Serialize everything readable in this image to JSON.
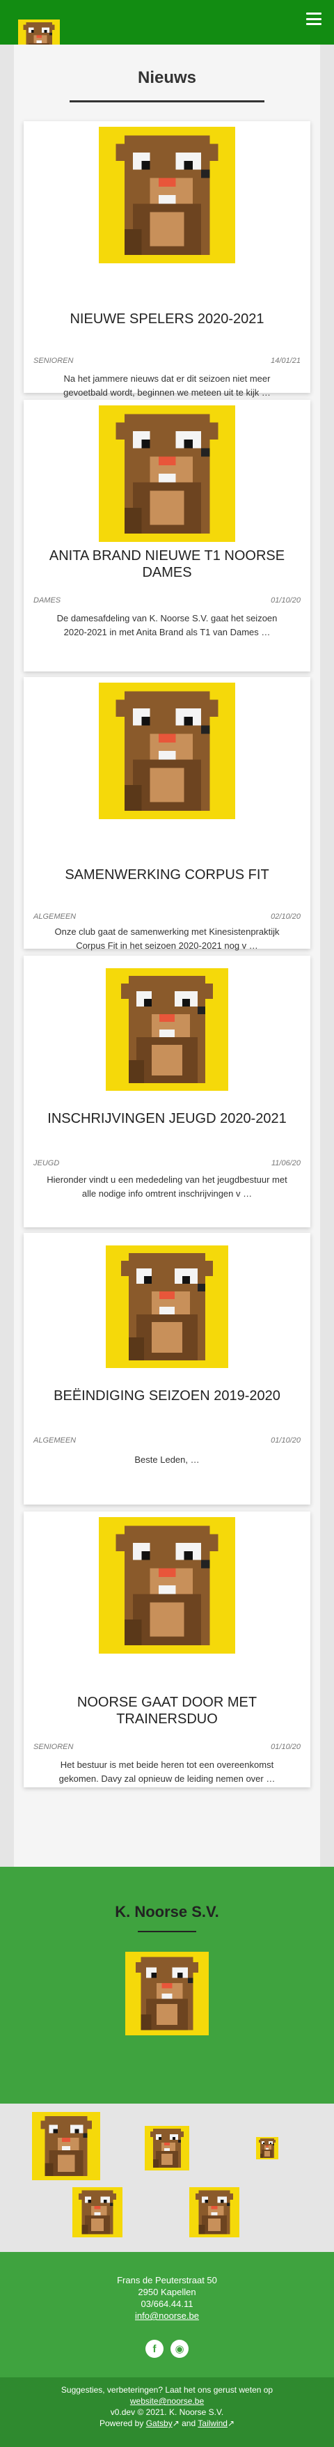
{
  "header": {
    "menu_icon": "hamburger-menu-icon",
    "logo": "beaver-logo-icon"
  },
  "colors": {
    "header_green": "#128c12",
    "band_green": "#3fa33f",
    "dark_green": "#2f8a2f",
    "beaver_brown": "#8a5a2b",
    "beaver_yellow": "#f5d90a"
  },
  "page": {
    "title": "Nieuws"
  },
  "articles": [
    {
      "title": "NIEUWE SPELERS 2020-2021",
      "category": "SENIOREN",
      "date": "14/01/21",
      "excerpt": "Na het jammere nieuws dat er dit seizoen niet meer gevoetbald wordt, beginnen we meteen uit te kijk …"
    },
    {
      "title": "ANITA BRAND NIEUWE T1 NOORSE DAMES",
      "category": "DAMES",
      "date": "01/10/20",
      "excerpt": "De damesafdeling van K. Noorse S.V. gaat het seizoen 2020-2021 in met Anita Brand als T1 van Dames …"
    },
    {
      "title": "SAMENWERKING CORPUS FIT",
      "category": "ALGEMEEN",
      "date": "02/10/20",
      "excerpt": "Onze club gaat de samenwerking met Kinesistenpraktijk Corpus Fit in het seizoen 2020-2021 nog v …"
    },
    {
      "title": "INSCHRIJVINGEN JEUGD 2020-2021",
      "category": "JEUGD",
      "date": "11/06/20",
      "excerpt": "Hieronder vindt u een mededeling van het jeugdbestuur met alle nodige info omtrent inschrijvingen v …"
    },
    {
      "title": "BEËINDIGING SEIZOEN 2019-2020",
      "category": "ALGEMEEN",
      "date": "01/10/20",
      "excerpt": "Beste Leden,    …"
    },
    {
      "title": "NOORSE GAAT DOOR MET TRAINERSDUO",
      "category": "SENIOREN",
      "date": "01/10/20",
      "excerpt": "Het bestuur is met beide heren tot een overeenkomst gekomen. Davy zal opnieuw de leiding nemen over …"
    }
  ],
  "club": {
    "name": "K. Noorse S.V."
  },
  "contact": {
    "address": "Frans de Peuterstraat 50",
    "city": "2950 Kapellen",
    "phone": "03/664.44.11",
    "email": "info@noorse.be"
  },
  "social": {
    "facebook_icon": "facebook-icon",
    "github_icon": "github-icon"
  },
  "footer": {
    "suggestion_text": "Suggesties, verbeteringen? Laat het ons gerust weten op",
    "suggestion_link": "website@noorse.be",
    "version_text": "v0.dev © 2021. K. Noorse S.V.",
    "powered_prefix": "Powered by",
    "gatsby_label": "Gatsby",
    "and_label": "and",
    "tailwind_label": "Tailwind"
  }
}
